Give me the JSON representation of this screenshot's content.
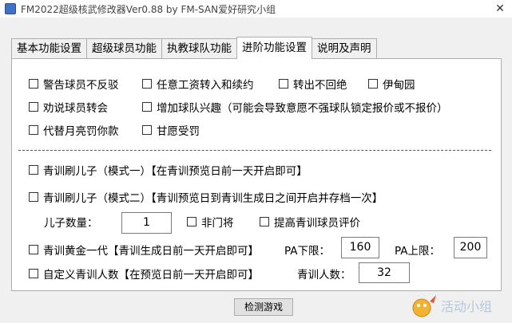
{
  "window": {
    "title": "FM2022超级核武修改器Ver0.88 by FM-SAN爱好研究小组",
    "close_glyph": "✕"
  },
  "tabs": [
    {
      "label": "基本功能设置"
    },
    {
      "label": "超级球员功能"
    },
    {
      "label": "执教球队功能"
    },
    {
      "label": "进阶功能设置"
    },
    {
      "label": "说明及声明"
    }
  ],
  "options": {
    "no_rebuttal": "警告球员不反驳",
    "any_wage": "任意工资转入和续约",
    "transfer_no_refuse": "转出不回绝",
    "eden": "伊甸园",
    "persuade_transfer": "劝说球员转会",
    "interest": "增加球队兴趣（可能会导致意愿不强球队锁定报价或不报价）",
    "pay_fine": "代替月亮罚你款",
    "accept_penalty": "甘愿受罚"
  },
  "youth": {
    "mode1_label": "青训刷儿子（模式一）【在青训预览日前一天开启即可】",
    "mode2_label": "青训刷儿子（模式二）【青训预览日到青训生成日之间开启并存档一次】",
    "son_count_label": "儿子数量：",
    "son_count_value": "1",
    "non_gk_label": "非门将",
    "improve_rating_label": "提高青训球员评价",
    "golden_label": "青训黄金一代【青训生成日前一天开启即可】",
    "pa_min_label": "PA下限：",
    "pa_min_value": "160",
    "pa_max_label": "PA上限：",
    "pa_max_value": "200",
    "custom_count_label": "自定义青训人数【在预览日前一天开启即可】",
    "count_label": "青训人数：",
    "count_value": "32"
  },
  "buttons": {
    "detect": "检测游戏"
  },
  "watermark": {
    "text": "活动小组"
  },
  "colors": {
    "window_bg": "#f0f0f0",
    "panel_bg": "#ffffff",
    "border": "#adadad"
  }
}
